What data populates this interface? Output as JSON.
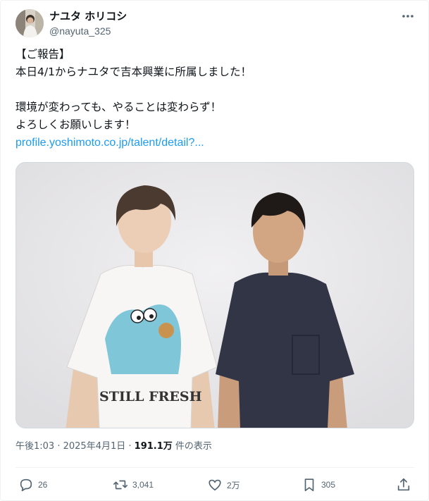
{
  "author": {
    "display_name": "ナユタ ホリコシ",
    "handle": "@nayuta_325",
    "avatar_icon": "avatar-photo"
  },
  "tweet": {
    "lines": [
      "【ご報告】",
      "本日4/1からナユタで吉本興業に所属しました！",
      "",
      "環境が変わっても、やることは変わらず！",
      "よろしくお願いします！"
    ],
    "link_text": "profile.yoshimoto.co.jp/talent/detail?..."
  },
  "meta": {
    "time": "午後1:03",
    "separator": " · ",
    "date": "2025年4月1日",
    "separator2": " · ",
    "views_count": "191.1万",
    "views_label": " 件の表示"
  },
  "actions": {
    "reply_count": "26",
    "retweet_count": "3,041",
    "like_count": "2万",
    "bookmark_count": "305"
  },
  "colors": {
    "link": "#1d9bf0",
    "secondary_text": "#536471",
    "primary_text": "#0f1419"
  }
}
